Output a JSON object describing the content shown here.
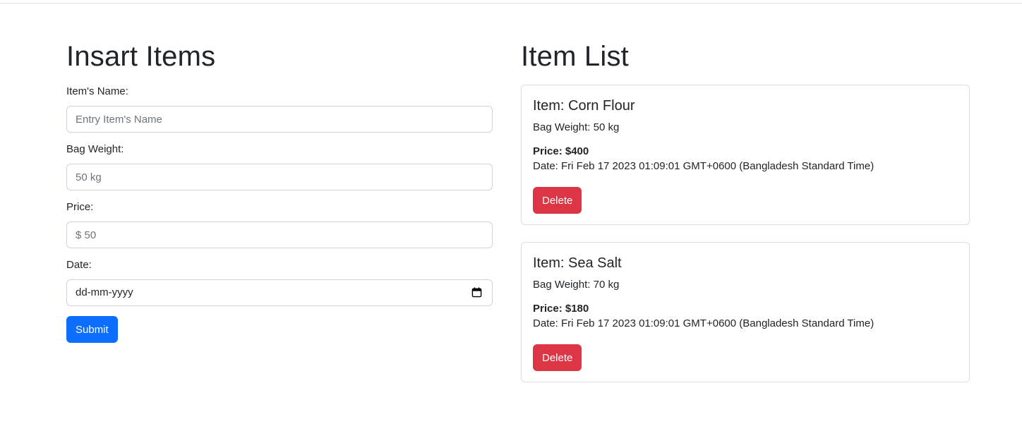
{
  "form": {
    "heading": "Insart Items",
    "name_label": "Item's Name:",
    "name_placeholder": "Entry Item's Name",
    "weight_label": "Bag Weight:",
    "weight_placeholder": "50 kg",
    "price_label": "Price:",
    "price_placeholder": "$ 50",
    "date_label": "Date:",
    "date_value": "dd-mm-yyyy",
    "date_icon": "calendar-icon",
    "submit_label": "Submit"
  },
  "list": {
    "heading": "Item List",
    "items": [
      {
        "title": "Item: Corn Flour",
        "weight": "Bag Weight: 50 kg",
        "price": "Price: $400",
        "date": "Date: Fri Feb 17 2023 01:09:01 GMT+0600 (Bangladesh Standard Time)",
        "delete_label": "Delete"
      },
      {
        "title": "Item: Sea Salt",
        "weight": "Bag Weight: 70 kg",
        "price": "Price: $180",
        "date": "Date: Fri Feb 17 2023 01:09:01 GMT+0600 (Bangladesh Standard Time)",
        "delete_label": "Delete"
      }
    ]
  },
  "colors": {
    "primary": "#0d6efd",
    "danger": "#dc3545",
    "text": "#212529",
    "border": "#ced4da"
  }
}
